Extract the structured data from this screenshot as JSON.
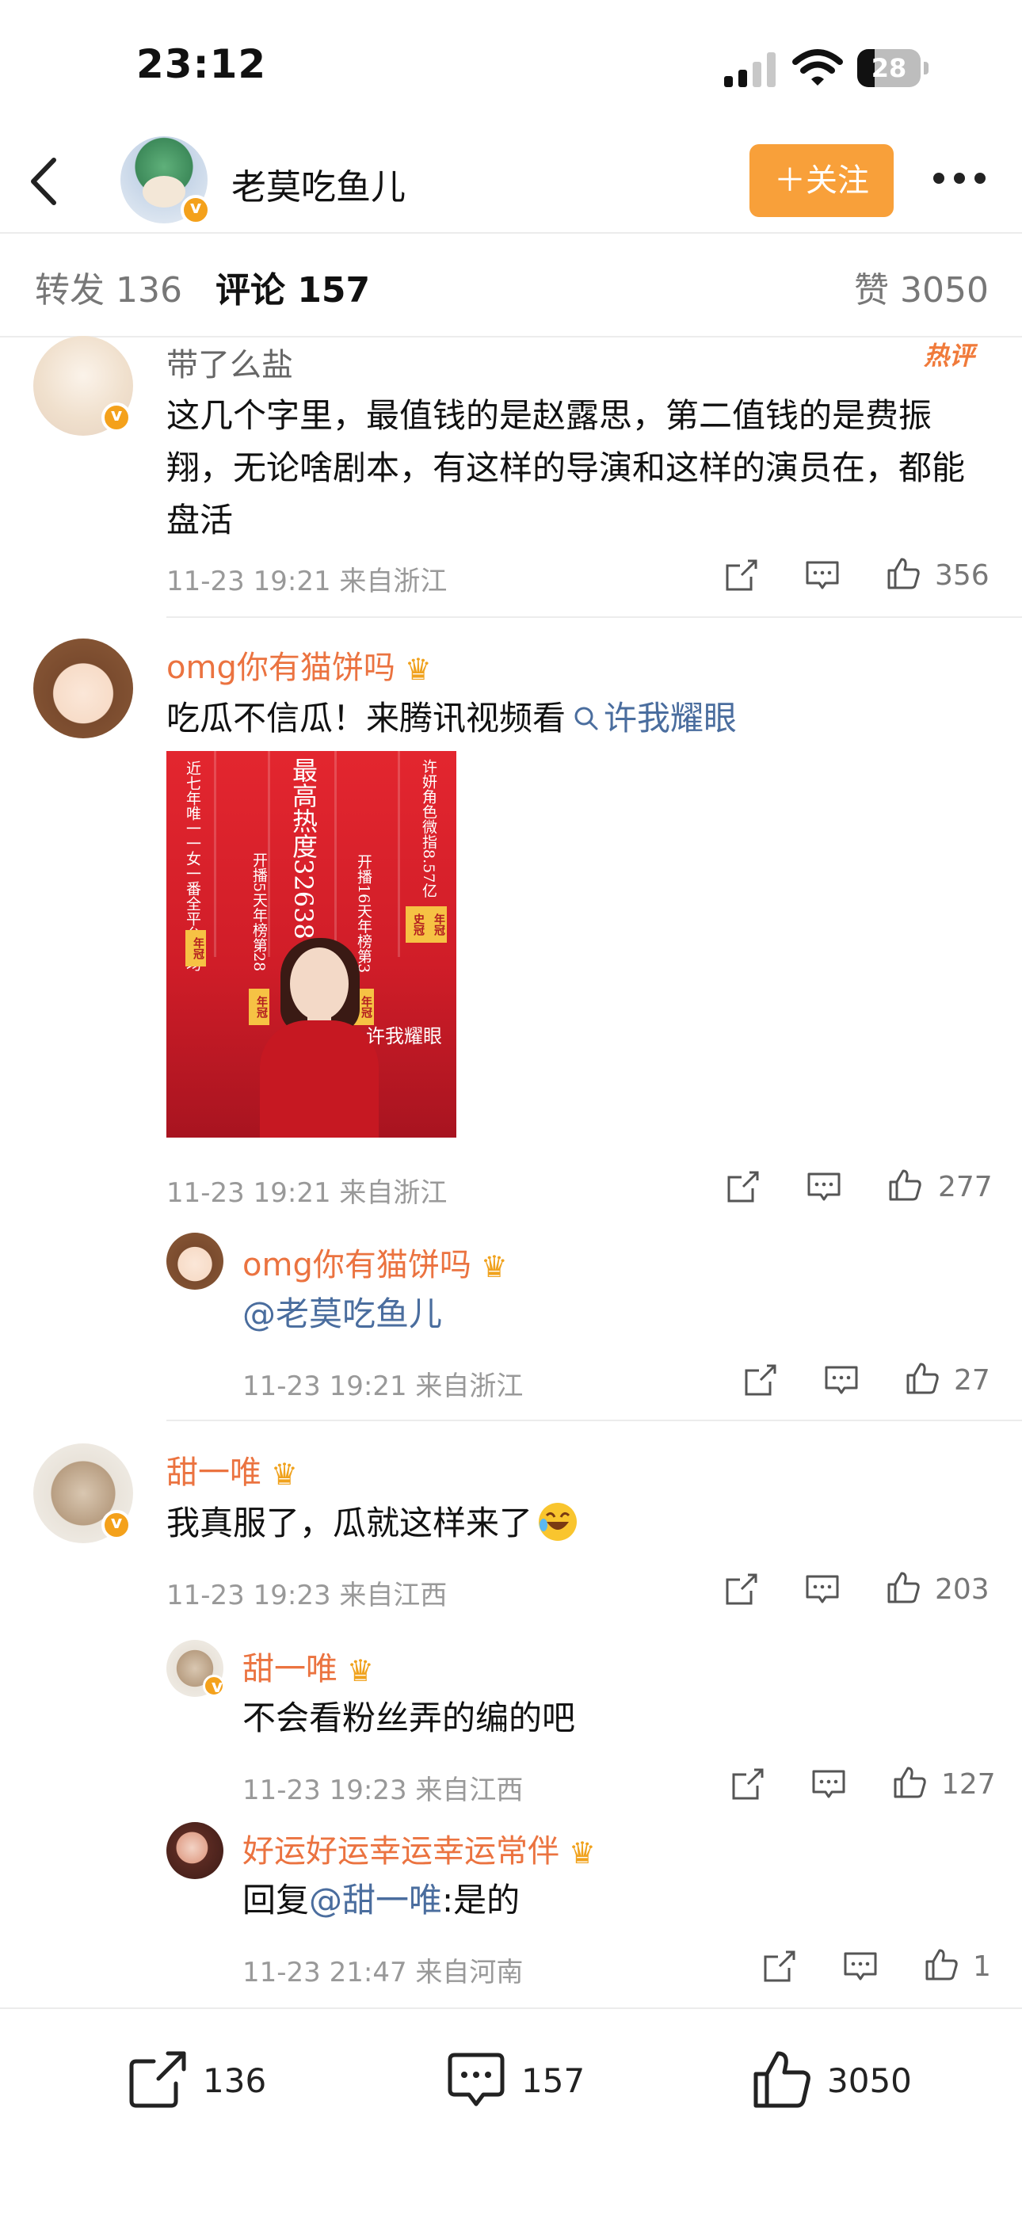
{
  "status_bar": {
    "time": "23:12",
    "battery": "28",
    "battery_level": 0.28
  },
  "header": {
    "username": "老莫吃鱼儿",
    "follow_label": "＋关注"
  },
  "tabs": {
    "repost": "转发 136",
    "comment": "评论 157",
    "like": "赞 3050"
  },
  "hot_tag": "热评",
  "comments": [
    {
      "user": "带了么盐",
      "text": "这几个字里，最值钱的是赵露思，第二值钱的是费振翔，无论啥剧本，有这样的导演和这样的演员在，都能盘活",
      "meta": "11-23 19:21 来自浙江",
      "likes": "356"
    },
    {
      "user": "omg你有猫饼吗",
      "text_prefix": "吃瓜不信瓜！来腾讯视频看",
      "search_link": "许我耀眼",
      "meta": "11-23 19:21 来自浙江",
      "likes": "277",
      "poster": {
        "col1": "近七年唯一一女一番全平台集均",
        "col2": "最高热度32638",
        "col3": "许妍角色微指8.57亿",
        "col4": "开播5天年榜第28",
        "col5": "开播16天年榜第3",
        "badge_year": "年冠",
        "badge_hist": "史冠",
        "logo": "许我耀眼"
      },
      "reply": {
        "user": "omg你有猫饼吗",
        "mention": "@老莫吃鱼儿",
        "meta": "11-23 19:21 来自浙江",
        "likes": "27"
      }
    },
    {
      "user": "甜一唯",
      "text": "我真服了，瓜就这样来了",
      "meta": "11-23 19:23 来自江西",
      "likes": "203",
      "replies": [
        {
          "user": "甜一唯",
          "text": "不会看粉丝弄的编的吧",
          "meta": "11-23 19:23 来自江西",
          "likes": "127"
        },
        {
          "user": "好运好运幸运幸运常伴",
          "text_prefix": "回复",
          "mention": "@甜一唯",
          "text_suffix": ":是的",
          "meta": "11-23 21:47 来自河南",
          "likes": "1"
        }
      ]
    }
  ],
  "bottom_bar": {
    "repost": "136",
    "comment": "157",
    "like": "3050"
  }
}
